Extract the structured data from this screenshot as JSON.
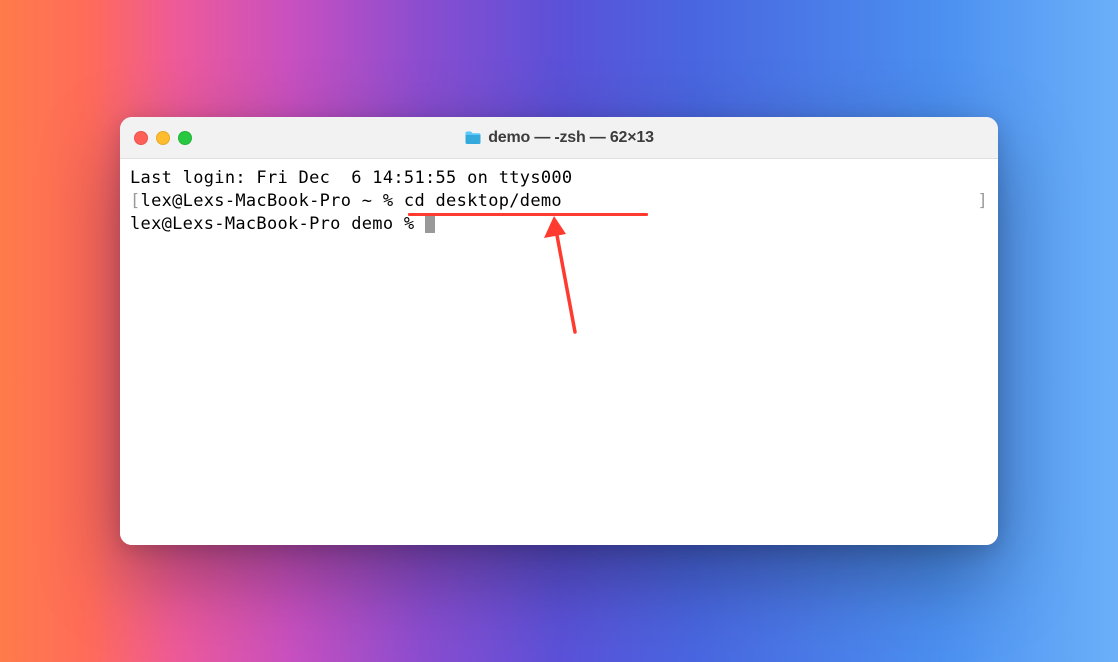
{
  "window": {
    "title": "demo — -zsh — 62×13"
  },
  "terminal": {
    "login_line": "Last login: Fri Dec  6 14:51:55 on ttys000",
    "prompt1_prefix": "lex@Lexs-MacBook-Pro ~ % ",
    "prompt1_command": "cd desktop/demo",
    "prompt2_prefix": "lex@Lexs-MacBook-Pro demo % "
  },
  "annotation": {
    "color": "#ff3b30"
  }
}
